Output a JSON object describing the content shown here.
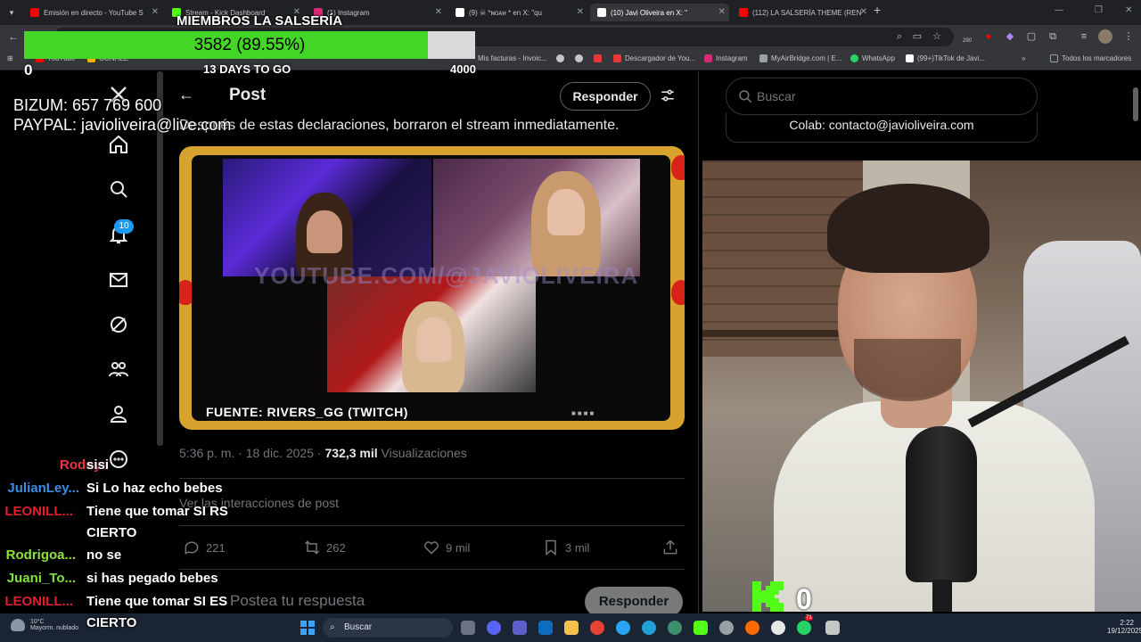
{
  "browser": {
    "tabs": [
      {
        "label": "Emisión en directo - YouTube S",
        "color": "#ff0000"
      },
      {
        "label": "Stream - Kick Dashboard",
        "color": "#53fc18"
      },
      {
        "label": "(1) Instagram",
        "color": "#d62976"
      },
      {
        "label": "(9) ☠ *ɴᴏᴀʜ * en X: \"qu",
        "color": "#ffffff"
      },
      {
        "label": "(10) Javi Oliveira en X: \"",
        "color": "#ffffff"
      },
      {
        "label": "(112) LA SALSERÍA THEME (REN",
        "color": "#ff0000"
      }
    ],
    "bookmarks": [
      {
        "label": "YouTube",
        "color": "#ff0000"
      },
      {
        "label": "CONALE",
        "color": "#f4b400"
      },
      {
        "label": "Mis facturas - Invoic...",
        "color": "#f4b400"
      },
      {
        "label": "Descargador de You...",
        "color": "#e53935"
      },
      {
        "label": "Instagram",
        "color": "#d62976"
      },
      {
        "label": "MyAirBridge.com | E...",
        "color": "#9aa0a6"
      },
      {
        "label": "WhatsApp",
        "color": "#25d366"
      },
      {
        "label": "(99+)TikTok de Javi...",
        "color": "#ffffff"
      },
      {
        "label": "Todos los marcadores",
        "color": "#9aa0a6"
      }
    ],
    "extension_badge": "290"
  },
  "overlay": {
    "title": "MIEMBROS LA SALSERÍA",
    "goal_text": "3582 (89.55%)",
    "goal_fraction": 0.8955,
    "goal_min": "0",
    "goal_max": "4000",
    "days_left": "13 DAYS TO GO",
    "bizum": "BIZUM: 657 769 600",
    "paypal": "PAYPAL: javioliveira@live.com",
    "kick_count": "0",
    "accent_green": "#43d626"
  },
  "x": {
    "notification_count": "10",
    "post_header": "Post",
    "reply_button": "Responder",
    "post_text": "Después de estas declaraciones, borraron el stream inmediatamente.",
    "watermark": "YOUTUBE.COM/@JAVIOLIVEIRA",
    "source_caption": "FUENTE: RIVERS_GG (TWITCH)",
    "time": "5:36 p. m.",
    "date": "18 dic. 2025",
    "views_count": "732,3 mil",
    "views_label": "Visualizaciones",
    "interactions_link": "Ver las interacciones de post",
    "replies": "221",
    "reposts": "262",
    "likes": "9 mil",
    "bookmarks": "3 mil",
    "reply_placeholder": "Postea tu respuesta",
    "reply_submit": "Responder",
    "search_placeholder": "Buscar",
    "colab": "Colab: contacto@javioliveira.com",
    "brand_blue": "#1d9bf0"
  },
  "chat": [
    {
      "user": "Rodnys",
      "msg": "sisi",
      "color": "#e8364a"
    },
    {
      "user": "JulianLey...",
      "msg": "Si Lo haz echo bebes",
      "color": "#3c8de6"
    },
    {
      "user": "LEONILL...",
      "msg": "Tiene que tomar SI RS",
      "msg2": "CIERTO",
      "color": "#e01e2e"
    },
    {
      "user": "Rodrigoa...",
      "msg": "no se",
      "color": "#8fe23a"
    },
    {
      "user": "Juani_To...",
      "msg": "si has pegado bebes",
      "color": "#7fe33a"
    },
    {
      "user": "LEONILL...",
      "msg": "Tiene que tomar SI ES",
      "msg2": "CIERTO",
      "color": "#e01e2e"
    }
  ],
  "taskbar": {
    "temperature": "10°C",
    "weather": "Mayorm. nublado",
    "search": "Buscar",
    "time": "2:22",
    "date": "19/12/2025",
    "whatsapp_badge": "71"
  }
}
